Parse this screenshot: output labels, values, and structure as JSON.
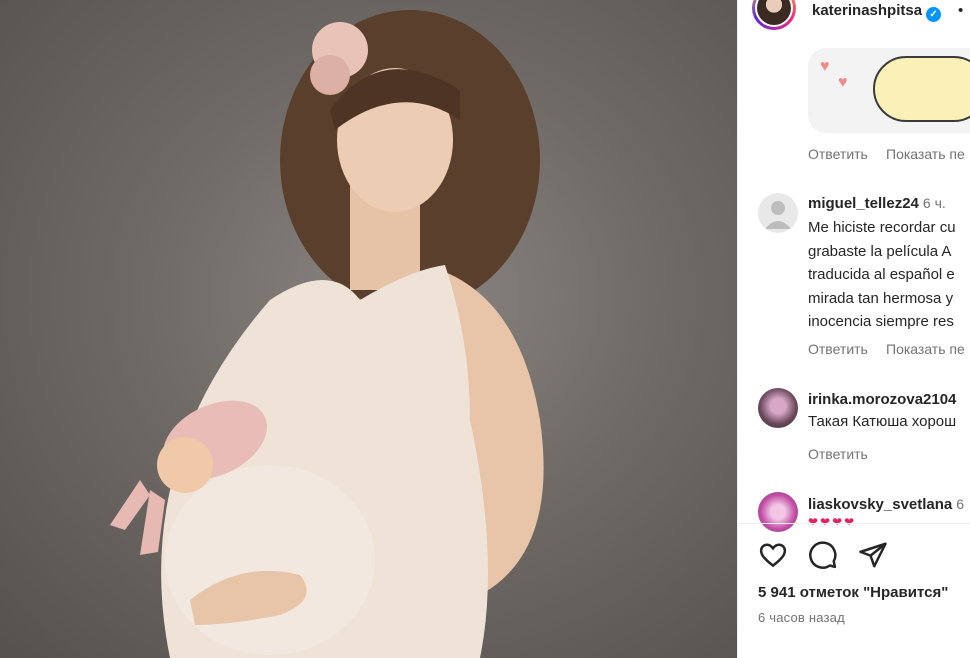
{
  "post": {
    "username": "katerinashpitsa",
    "verified": true,
    "more_dot": "•"
  },
  "comments": [
    {
      "reply_label": "Ответить",
      "show_label": "Показать пе"
    },
    {
      "username": "miguel_tellez24",
      "time": "6 ч.",
      "lines": [
        "Me hiciste recordar cu",
        "grabaste la película A",
        "traducida al español e",
        "mirada tan hermosa y",
        "inocencia siempre res"
      ],
      "reply_label": "Ответить",
      "show_label": "Показать пе"
    },
    {
      "username": "irinka.morozova2104",
      "text": "Такая Катюша хорош",
      "reply_label": "Ответить"
    },
    {
      "username": "liaskovsky_svetlana",
      "time": "6",
      "text": "❤❤❤❤"
    }
  ],
  "actions": {
    "like_icon": "heart-icon",
    "comment_icon": "comment-icon",
    "share_icon": "share-icon"
  },
  "likes_text": "5 941 отметок \"Нравится\"",
  "time_ago": "6 часов назад",
  "colors": {
    "link_gray": "#737373",
    "verified_blue": "#0095f6",
    "text": "#262626"
  }
}
